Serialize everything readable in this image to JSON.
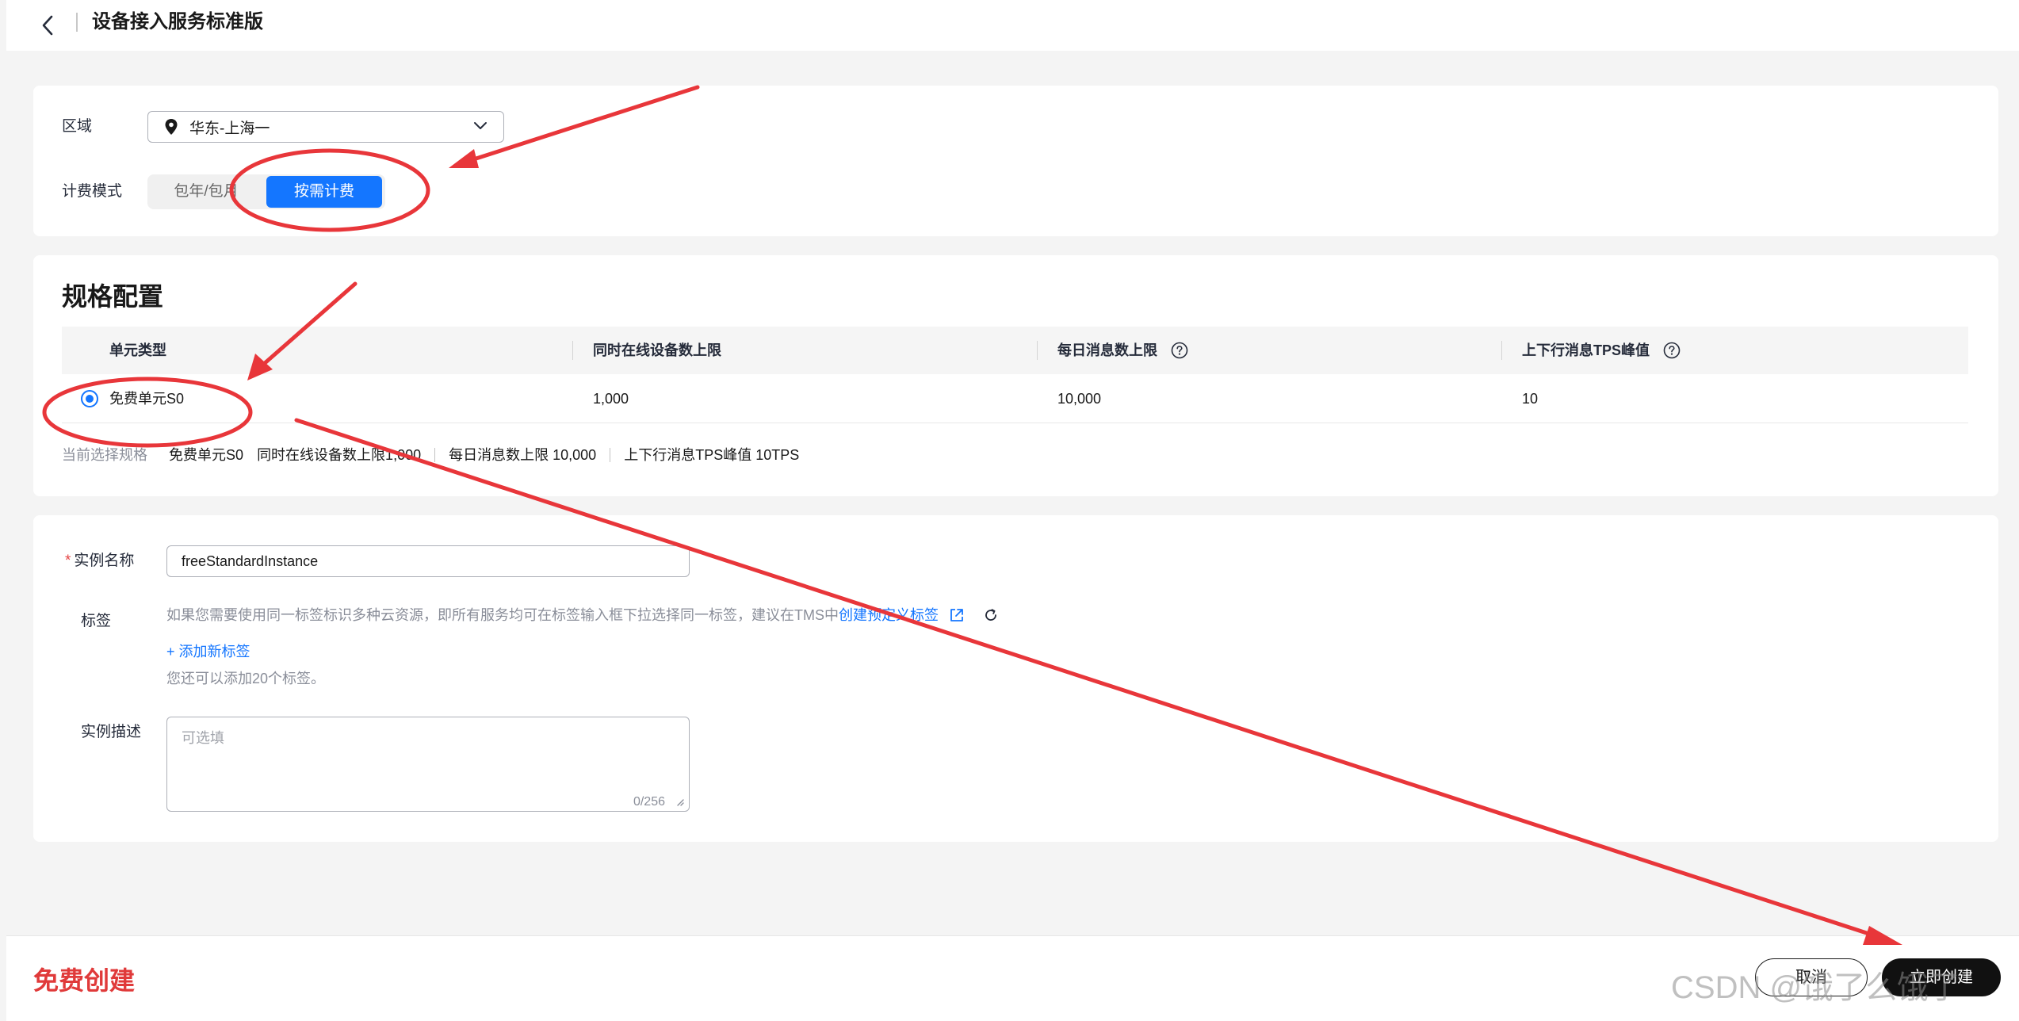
{
  "header": {
    "title": "设备接入服务标准版"
  },
  "basic": {
    "region_label": "区域",
    "region_value": "华东-上海一",
    "billing_label": "计费模式",
    "billing_options": [
      "包年/包月",
      "按需计费"
    ],
    "billing_selected": "按需计费"
  },
  "spec": {
    "title": "规格配置",
    "columns": [
      "单元类型",
      "同时在线设备数上限",
      "每日消息数上限",
      "上下行消息TPS峰值"
    ],
    "rows": [
      {
        "type": "免费单元S0",
        "max_online": "1,000",
        "daily_msgs": "10,000",
        "tps": "10",
        "selected": true
      }
    ],
    "summary": {
      "label": "当前选择规格",
      "unit": "免费单元S0",
      "online": "同时在线设备数上限1,000",
      "daily": "每日消息数上限 10,000",
      "tps": "上下行消息TPS峰值 10TPS"
    }
  },
  "instance": {
    "name_label": "实例名称",
    "name_value": "freeStandardInstance",
    "tag_label": "标签",
    "tag_hint": "如果您需要使用同一标签标识多种云资源，即所有服务均可在标签输入框下拉选择同一标签，建议在TMS中",
    "tag_link": "创建预定义标签",
    "add_tag": "+ 添加新标签",
    "tag_remaining": "您还可以添加20个标签。",
    "desc_label": "实例描述",
    "desc_placeholder": "可选填",
    "desc_counter": "0/256"
  },
  "footer": {
    "title": "免费创建",
    "cancel": "取消",
    "create": "立即创建"
  },
  "watermark": "CSDN @饿了么饿了",
  "colors": {
    "primary": "#1476ff",
    "annotation_red": "#e8363a",
    "footer_title": "#e03a3a"
  }
}
